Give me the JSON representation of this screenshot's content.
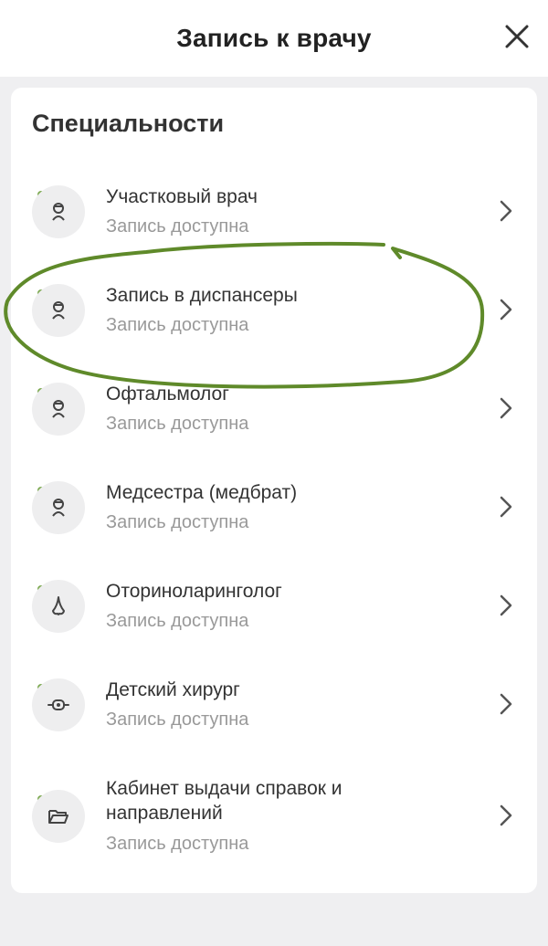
{
  "header": {
    "title": "Запись к врачу"
  },
  "section": {
    "title": "Специальности"
  },
  "items": [
    {
      "title": "Участковый врач",
      "status": "Запись доступна",
      "icon": "doctor-icon"
    },
    {
      "title": "Запись в диспансеры",
      "status": "Запись доступна",
      "icon": "doctor-icon"
    },
    {
      "title": "Офтальмолог",
      "status": "Запись доступна",
      "icon": "doctor-icon"
    },
    {
      "title": "Медсестра (медбрат)",
      "status": "Запись доступна",
      "icon": "doctor-icon"
    },
    {
      "title": "Оториноларинголог",
      "status": "Запись доступна",
      "icon": "nose-icon"
    },
    {
      "title": "Детский хирург",
      "status": "Запись доступна",
      "icon": "bandage-icon"
    },
    {
      "title_line1": "Кабинет выдачи справок и",
      "title_line2": "направлений",
      "status": "Запись доступна",
      "icon": "folder-icon"
    }
  ],
  "colors": {
    "status_dot": "#7fab55",
    "annotation": "#5f8a2a"
  }
}
